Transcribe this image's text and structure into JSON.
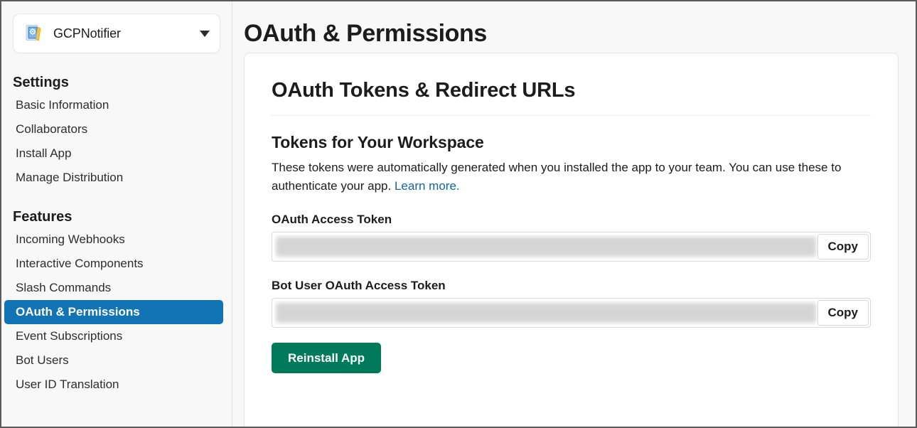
{
  "sidebar": {
    "app_switcher": {
      "app_name": "GCPNotifier",
      "icon": "app-notebook-icon",
      "caret_icon": "chevron-down-icon"
    },
    "sections": [
      {
        "title": "Settings",
        "items": [
          {
            "label": "Basic Information",
            "active": false
          },
          {
            "label": "Collaborators",
            "active": false
          },
          {
            "label": "Install App",
            "active": false
          },
          {
            "label": "Manage Distribution",
            "active": false
          }
        ]
      },
      {
        "title": "Features",
        "items": [
          {
            "label": "Incoming Webhooks",
            "active": false
          },
          {
            "label": "Interactive Components",
            "active": false
          },
          {
            "label": "Slash Commands",
            "active": false
          },
          {
            "label": "OAuth & Permissions",
            "active": true
          },
          {
            "label": "Event Subscriptions",
            "active": false
          },
          {
            "label": "Bot Users",
            "active": false
          },
          {
            "label": "User ID Translation",
            "active": false
          }
        ]
      }
    ]
  },
  "main": {
    "page_title": "OAuth & Permissions",
    "card": {
      "title": "OAuth Tokens & Redirect URLs",
      "section_title": "Tokens for Your Workspace",
      "description_part1": "These tokens were automatically generated when you installed the app to your team. You can use these to authenticate your app. ",
      "description_link": "Learn more.",
      "fields": [
        {
          "label": "OAuth Access Token",
          "value": "",
          "redacted": true,
          "copy_label": "Copy"
        },
        {
          "label": "Bot User OAuth Access Token",
          "value": "",
          "redacted": true,
          "copy_label": "Copy"
        }
      ],
      "primary_button": "Reinstall App"
    }
  },
  "colors": {
    "accent_blue": "#1273b5",
    "link_blue": "#1264a3",
    "primary_green": "#007a5a",
    "sidebar_bg": "#f8f8f8",
    "card_bg": "#ffffff"
  }
}
